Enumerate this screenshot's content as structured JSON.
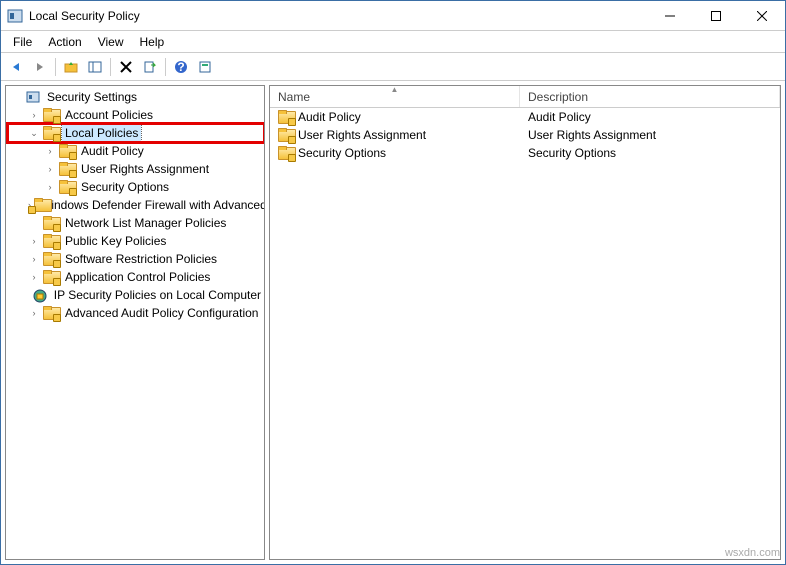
{
  "window": {
    "title": "Local Security Policy"
  },
  "menu": {
    "file": "File",
    "action": "Action",
    "view": "View",
    "help": "Help"
  },
  "toolbar": {
    "back": "back",
    "forward": "forward",
    "up": "up",
    "show": "show-hide-tree",
    "delete": "delete",
    "export": "export-list",
    "help": "help",
    "refresh": "refresh"
  },
  "tree": {
    "root": "Security Settings",
    "items": [
      {
        "label": "Account Policies",
        "expandable": true,
        "indent": 1
      },
      {
        "label": "Local Policies",
        "expandable": true,
        "indent": 1,
        "highlighted": true,
        "selected": true,
        "expanded": true
      },
      {
        "label": "Audit Policy",
        "expandable": true,
        "indent": 2
      },
      {
        "label": "User Rights Assignment",
        "expandable": true,
        "indent": 2
      },
      {
        "label": "Security Options",
        "expandable": true,
        "indent": 2
      },
      {
        "label": "Windows Defender Firewall with Advanced Security",
        "expandable": true,
        "indent": 1
      },
      {
        "label": "Network List Manager Policies",
        "expandable": false,
        "indent": 1
      },
      {
        "label": "Public Key Policies",
        "expandable": true,
        "indent": 1
      },
      {
        "label": "Software Restriction Policies",
        "expandable": true,
        "indent": 1
      },
      {
        "label": "Application Control Policies",
        "expandable": true,
        "indent": 1
      },
      {
        "label": "IP Security Policies on Local Computer",
        "expandable": false,
        "indent": 1,
        "icon": "ipsec"
      },
      {
        "label": "Advanced Audit Policy Configuration",
        "expandable": true,
        "indent": 1
      }
    ]
  },
  "list": {
    "columns": {
      "name": "Name",
      "description": "Description"
    },
    "rows": [
      {
        "name": "Audit Policy",
        "description": "Audit Policy"
      },
      {
        "name": "User Rights Assignment",
        "description": "User Rights Assignment"
      },
      {
        "name": "Security Options",
        "description": "Security Options"
      }
    ]
  },
  "watermark": "wsxdn.com"
}
